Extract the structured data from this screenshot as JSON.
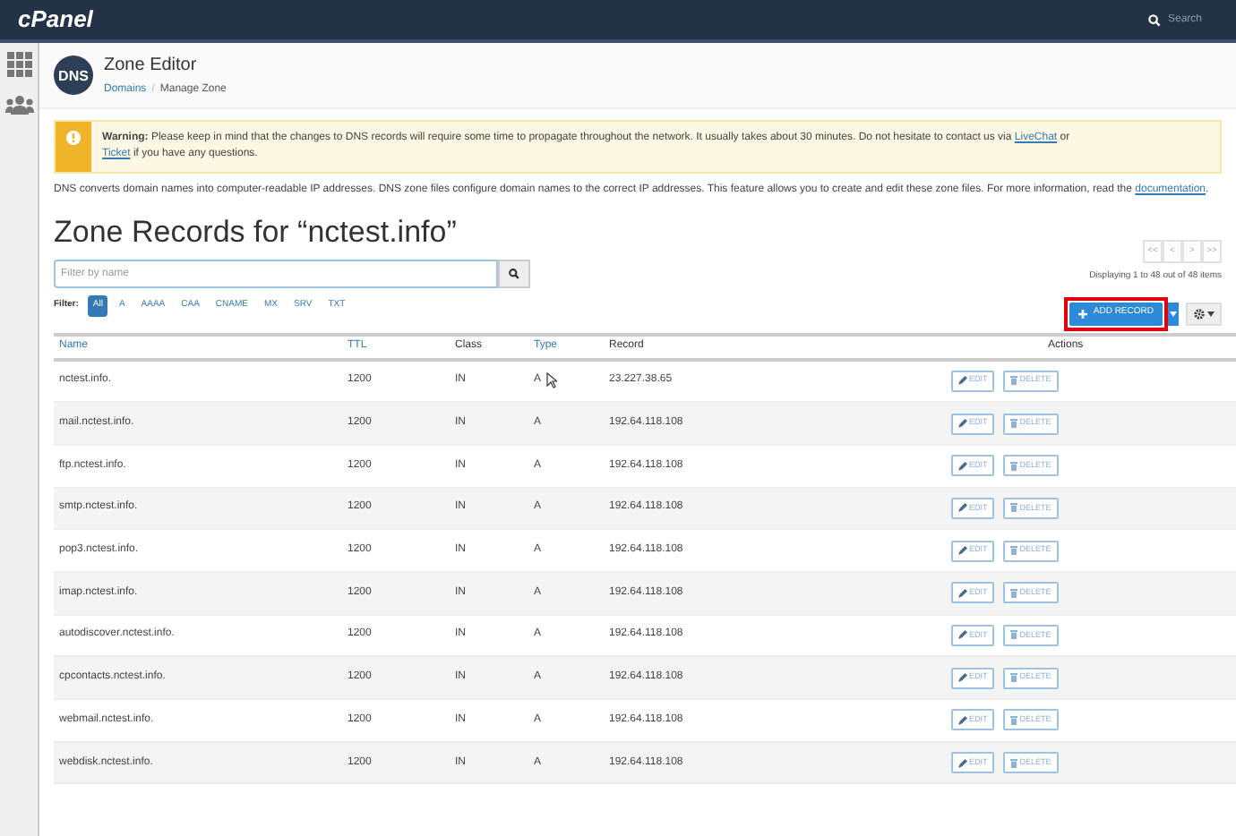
{
  "topbar": {
    "logo": "cPanel",
    "search_placeholder": "Search"
  },
  "header": {
    "icon_text": "DNS",
    "title": "Zone Editor",
    "separator": "/",
    "breadcrumb": [
      {
        "label": "Domains",
        "link": true
      },
      {
        "label": "Manage Zone",
        "link": false
      }
    ]
  },
  "warning": {
    "label": "Warning:",
    "text_1": "Please keep in mind that the changes to DNS records will require some time to propagate throughout the network. It usually takes about 30 minutes. Do not hesitate to contact us via",
    "link_1": "LiveChat",
    "text_2": "or",
    "link_2": "Ticket",
    "text_3": "if you have any questions."
  },
  "description": {
    "text": "DNS converts domain names into computer-readable IP addresses. DNS zone files configure domain names to the correct IP addresses. This feature allows you to create and edit these zone files. For more information, read the",
    "link": "documentation",
    "end": "."
  },
  "zone_title": "Zone Records for “nctest.info”",
  "filter": {
    "placeholder": "Filter by name",
    "label": "Filter:",
    "types": [
      {
        "label": "All",
        "selected": true
      },
      {
        "label": "A",
        "selected": false
      },
      {
        "label": "AAAA",
        "selected": false
      },
      {
        "label": "CAA",
        "selected": false
      },
      {
        "label": "CNAME",
        "selected": false
      },
      {
        "label": "MX",
        "selected": false
      },
      {
        "label": "SRV",
        "selected": false
      },
      {
        "label": "TXT",
        "selected": false
      }
    ]
  },
  "pagination": {
    "buttons": [
      "<<",
      "<",
      ">",
      ">>"
    ],
    "summary": "Displaying 1 to 48 out of 48 items"
  },
  "add_record": {
    "label": "ADD RECORD",
    "highlighted": true
  },
  "table": {
    "columns": [
      {
        "label": "Name",
        "sortable": true
      },
      {
        "label": "TTL",
        "sortable": true
      },
      {
        "label": "Class",
        "sortable": false
      },
      {
        "label": "Type",
        "sortable": true
      },
      {
        "label": "Record",
        "sortable": false
      },
      {
        "label": "Actions",
        "sortable": false
      }
    ],
    "rows": [
      {
        "name": "nctest.info.",
        "ttl": "1200",
        "class": "IN",
        "type": "A",
        "record": "23.227.38.65",
        "edit": "EDIT",
        "delete": "DELETE"
      },
      {
        "name": "mail.nctest.info.",
        "ttl": "1200",
        "class": "IN",
        "type": "A",
        "record": "192.64.118.108",
        "edit": "EDIT",
        "delete": "DELETE"
      },
      {
        "name": "ftp.nctest.info.",
        "ttl": "1200",
        "class": "IN",
        "type": "A",
        "record": "192.64.118.108",
        "edit": "EDIT",
        "delete": "DELETE"
      },
      {
        "name": "smtp.nctest.info.",
        "ttl": "1200",
        "class": "IN",
        "type": "A",
        "record": "192.64.118.108",
        "edit": "EDIT",
        "delete": "DELETE"
      },
      {
        "name": "pop3.nctest.info.",
        "ttl": "1200",
        "class": "IN",
        "type": "A",
        "record": "192.64.118.108",
        "edit": "EDIT",
        "delete": "DELETE"
      },
      {
        "name": "imap.nctest.info.",
        "ttl": "1200",
        "class": "IN",
        "type": "A",
        "record": "192.64.118.108",
        "edit": "EDIT",
        "delete": "DELETE"
      },
      {
        "name": "autodiscover.nctest.info.",
        "ttl": "1200",
        "class": "IN",
        "type": "A",
        "record": "192.64.118.108",
        "edit": "EDIT",
        "delete": "DELETE"
      },
      {
        "name": "cpcontacts.nctest.info.",
        "ttl": "1200",
        "class": "IN",
        "type": "A",
        "record": "192.64.118.108",
        "edit": "EDIT",
        "delete": "DELETE"
      },
      {
        "name": "webmail.nctest.info.",
        "ttl": "1200",
        "class": "IN",
        "type": "A",
        "record": "192.64.118.108",
        "edit": "EDIT",
        "delete": "DELETE"
      },
      {
        "name": "webdisk.nctest.info.",
        "ttl": "1200",
        "class": "IN",
        "type": "A",
        "record": "192.64.118.108",
        "edit": "EDIT",
        "delete": "DELETE"
      }
    ]
  }
}
